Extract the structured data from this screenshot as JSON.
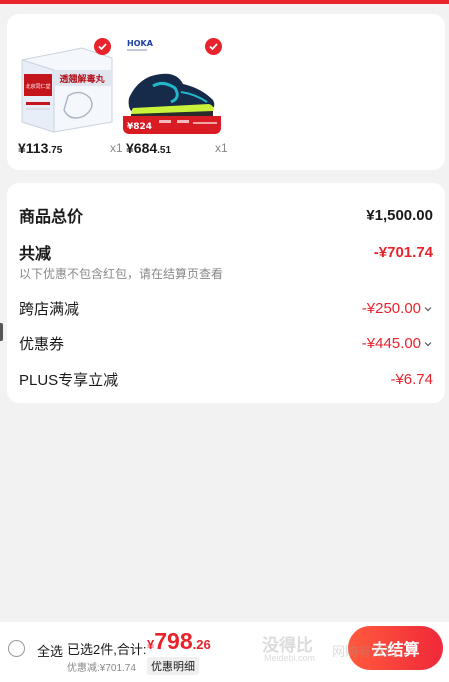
{
  "colors": {
    "accent": "#e8232c",
    "page_bg": "#f2f2f2",
    "card_bg": "#ffffff"
  },
  "products": [
    {
      "name": "medicine-box",
      "image_text": "透翘解毒丸",
      "image_brand": "北京同仁堂",
      "price_main": "¥113",
      "price_decimal": ".75",
      "quantity": "x1",
      "selected": true
    },
    {
      "name": "hoka-shoe",
      "image_brand": "HOKA",
      "image_tag": "¥824",
      "price_main": "¥684",
      "price_decimal": ".51",
      "quantity": "x1",
      "selected": true
    }
  ],
  "summary": {
    "total_label": "商品总价",
    "total_value": "¥1,500.00",
    "reduction_label": "共减",
    "reduction_value": "-¥701.74",
    "reduction_note": "以下优惠不包含红包，请在结算页查看",
    "cross_store_label": "跨店满减",
    "cross_store_value": "-¥250.00",
    "coupon_label": "优惠券",
    "coupon_value": "-¥445.00",
    "plus_label": "PLUS专享立减",
    "plus_value": "-¥6.74"
  },
  "bottom_bar": {
    "select_all": "全选",
    "selected_count": "已选2件,合计:",
    "currency": "¥",
    "total_big": "798",
    "total_decimal": ".26",
    "discount_line": "优惠减:¥701.74",
    "detail_link": "优惠明细",
    "checkout_button": "去结算"
  },
  "watermark": {
    "big": "没得比",
    "small": "Meidebi.com",
    "right": "网购有得比"
  }
}
